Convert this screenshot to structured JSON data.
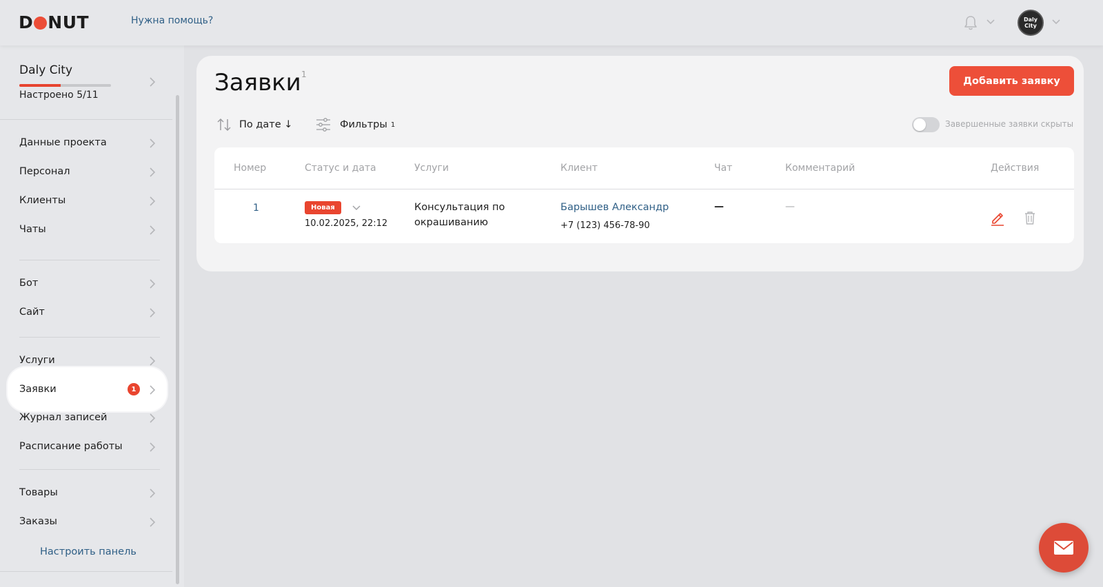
{
  "header": {
    "logo_text_left": "D",
    "logo_text_right": "NUT",
    "help_link": "Нужна помощь?",
    "avatar_text_line1": "Daly",
    "avatar_text_line2": "City"
  },
  "sidebar": {
    "project": {
      "name": "Daly City",
      "status": "Настроено 5/11",
      "progress_fraction": 0.4545
    },
    "groups": [
      [
        {
          "label": "Данные проекта"
        },
        {
          "label": "Персонал"
        },
        {
          "label": "Клиенты"
        },
        {
          "label": "Чаты"
        }
      ],
      [
        {
          "label": "Бот"
        },
        {
          "label": "Сайт"
        }
      ],
      [
        {
          "label": "Услуги"
        },
        {
          "label": "Заявки",
          "badge": "1",
          "active": true
        },
        {
          "label": "Журнал записей"
        },
        {
          "label": "Расписание работы"
        }
      ],
      [
        {
          "label": "Товары"
        },
        {
          "label": "Заказы"
        }
      ]
    ],
    "customize_link": "Настроить панель"
  },
  "main": {
    "title": "Заявки",
    "title_count": "1",
    "add_button": "Добавить заявку",
    "sort_label": "По дате ↓",
    "filter_label": "Фильтры",
    "filter_count": "1",
    "toggle_label": "Завершенные заявки скрыты",
    "toggle_on": false,
    "table": {
      "columns": [
        "Номер",
        "Статус и дата",
        "Услуги",
        "Клиент",
        "Чат",
        "Комментарий",
        "Действия"
      ],
      "rows": [
        {
          "number": "1",
          "status": "Новая",
          "date": "10.02.2025, 22:12",
          "service_line1": "Консультация по",
          "service_line2": "окрашиванию",
          "client_name": "Барышев Александр",
          "client_phone": "+7 (123) 456-78-90",
          "chat": "—",
          "comment": "—"
        }
      ]
    }
  },
  "colors": {
    "accent": "#ed4f39",
    "link": "#2f5f86",
    "background": "#e1e2e5",
    "card": "#f3f3f4"
  },
  "icons": [
    "bell-icon",
    "chevron-down-icon",
    "chevron-right-icon",
    "sort-icon",
    "filter-icon",
    "edit-icon",
    "trash-icon",
    "mail-icon"
  ]
}
